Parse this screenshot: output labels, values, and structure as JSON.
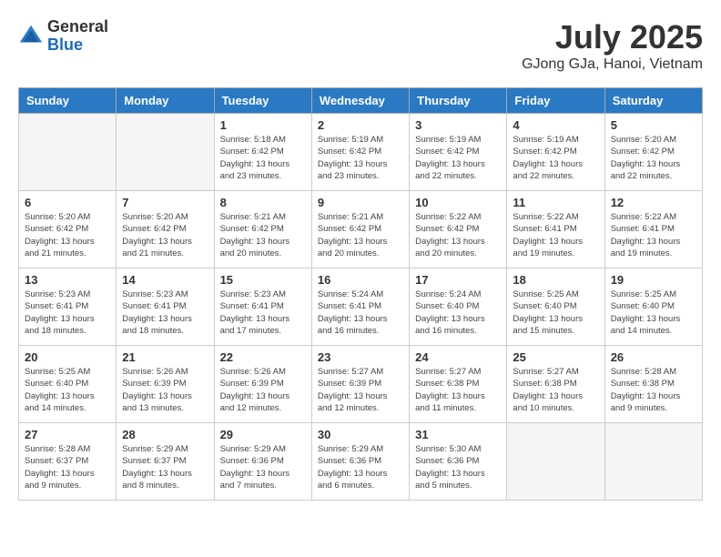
{
  "header": {
    "logo_general": "General",
    "logo_blue": "Blue",
    "month_year": "July 2025",
    "location": "GJong GJa, Hanoi, Vietnam"
  },
  "weekdays": [
    "Sunday",
    "Monday",
    "Tuesday",
    "Wednesday",
    "Thursday",
    "Friday",
    "Saturday"
  ],
  "weeks": [
    [
      {
        "day": "",
        "empty": true
      },
      {
        "day": "",
        "empty": true
      },
      {
        "day": "1",
        "sunrise": "5:18 AM",
        "sunset": "6:42 PM",
        "daylight": "13 hours and 23 minutes."
      },
      {
        "day": "2",
        "sunrise": "5:19 AM",
        "sunset": "6:42 PM",
        "daylight": "13 hours and 23 minutes."
      },
      {
        "day": "3",
        "sunrise": "5:19 AM",
        "sunset": "6:42 PM",
        "daylight": "13 hours and 22 minutes."
      },
      {
        "day": "4",
        "sunrise": "5:19 AM",
        "sunset": "6:42 PM",
        "daylight": "13 hours and 22 minutes."
      },
      {
        "day": "5",
        "sunrise": "5:20 AM",
        "sunset": "6:42 PM",
        "daylight": "13 hours and 22 minutes."
      }
    ],
    [
      {
        "day": "6",
        "sunrise": "5:20 AM",
        "sunset": "6:42 PM",
        "daylight": "13 hours and 21 minutes."
      },
      {
        "day": "7",
        "sunrise": "5:20 AM",
        "sunset": "6:42 PM",
        "daylight": "13 hours and 21 minutes."
      },
      {
        "day": "8",
        "sunrise": "5:21 AM",
        "sunset": "6:42 PM",
        "daylight": "13 hours and 20 minutes."
      },
      {
        "day": "9",
        "sunrise": "5:21 AM",
        "sunset": "6:42 PM",
        "daylight": "13 hours and 20 minutes."
      },
      {
        "day": "10",
        "sunrise": "5:22 AM",
        "sunset": "6:42 PM",
        "daylight": "13 hours and 20 minutes."
      },
      {
        "day": "11",
        "sunrise": "5:22 AM",
        "sunset": "6:41 PM",
        "daylight": "13 hours and 19 minutes."
      },
      {
        "day": "12",
        "sunrise": "5:22 AM",
        "sunset": "6:41 PM",
        "daylight": "13 hours and 19 minutes."
      }
    ],
    [
      {
        "day": "13",
        "sunrise": "5:23 AM",
        "sunset": "6:41 PM",
        "daylight": "13 hours and 18 minutes."
      },
      {
        "day": "14",
        "sunrise": "5:23 AM",
        "sunset": "6:41 PM",
        "daylight": "13 hours and 18 minutes."
      },
      {
        "day": "15",
        "sunrise": "5:23 AM",
        "sunset": "6:41 PM",
        "daylight": "13 hours and 17 minutes."
      },
      {
        "day": "16",
        "sunrise": "5:24 AM",
        "sunset": "6:41 PM",
        "daylight": "13 hours and 16 minutes."
      },
      {
        "day": "17",
        "sunrise": "5:24 AM",
        "sunset": "6:40 PM",
        "daylight": "13 hours and 16 minutes."
      },
      {
        "day": "18",
        "sunrise": "5:25 AM",
        "sunset": "6:40 PM",
        "daylight": "13 hours and 15 minutes."
      },
      {
        "day": "19",
        "sunrise": "5:25 AM",
        "sunset": "6:40 PM",
        "daylight": "13 hours and 14 minutes."
      }
    ],
    [
      {
        "day": "20",
        "sunrise": "5:25 AM",
        "sunset": "6:40 PM",
        "daylight": "13 hours and 14 minutes."
      },
      {
        "day": "21",
        "sunrise": "5:26 AM",
        "sunset": "6:39 PM",
        "daylight": "13 hours and 13 minutes."
      },
      {
        "day": "22",
        "sunrise": "5:26 AM",
        "sunset": "6:39 PM",
        "daylight": "13 hours and 12 minutes."
      },
      {
        "day": "23",
        "sunrise": "5:27 AM",
        "sunset": "6:39 PM",
        "daylight": "13 hours and 12 minutes."
      },
      {
        "day": "24",
        "sunrise": "5:27 AM",
        "sunset": "6:38 PM",
        "daylight": "13 hours and 11 minutes."
      },
      {
        "day": "25",
        "sunrise": "5:27 AM",
        "sunset": "6:38 PM",
        "daylight": "13 hours and 10 minutes."
      },
      {
        "day": "26",
        "sunrise": "5:28 AM",
        "sunset": "6:38 PM",
        "daylight": "13 hours and 9 minutes."
      }
    ],
    [
      {
        "day": "27",
        "sunrise": "5:28 AM",
        "sunset": "6:37 PM",
        "daylight": "13 hours and 9 minutes."
      },
      {
        "day": "28",
        "sunrise": "5:29 AM",
        "sunset": "6:37 PM",
        "daylight": "13 hours and 8 minutes."
      },
      {
        "day": "29",
        "sunrise": "5:29 AM",
        "sunset": "6:36 PM",
        "daylight": "13 hours and 7 minutes."
      },
      {
        "day": "30",
        "sunrise": "5:29 AM",
        "sunset": "6:36 PM",
        "daylight": "13 hours and 6 minutes."
      },
      {
        "day": "31",
        "sunrise": "5:30 AM",
        "sunset": "6:36 PM",
        "daylight": "13 hours and 5 minutes."
      },
      {
        "day": "",
        "empty": true
      },
      {
        "day": "",
        "empty": true
      }
    ]
  ],
  "labels": {
    "sunrise_prefix": "Sunrise: ",
    "sunset_prefix": "Sunset: ",
    "daylight_prefix": "Daylight: "
  }
}
